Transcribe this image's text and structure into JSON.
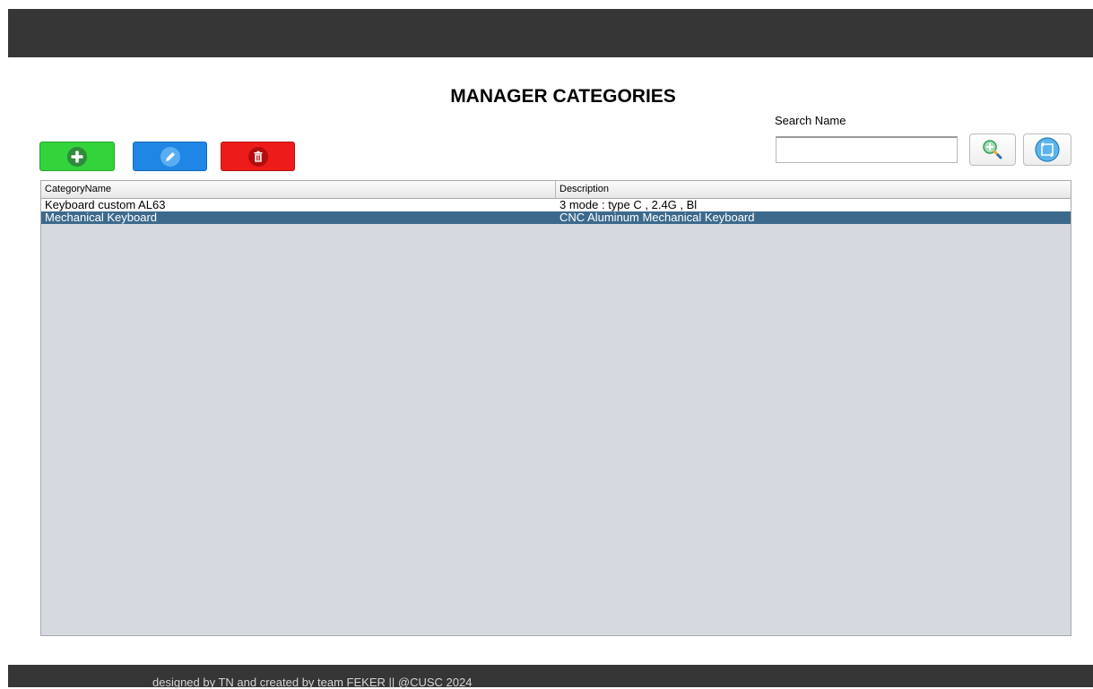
{
  "page": {
    "title": "MANAGER CATEGORIES",
    "footer_text": "designed by TN and created by team FEKER || @CUSC 2024"
  },
  "search": {
    "label": "Search Name",
    "value": "",
    "search_button_icon": "search-add-icon",
    "refresh_button_icon": "refresh-icon"
  },
  "toolbar": {
    "add_icon": "plus-icon",
    "edit_icon": "pencil-icon",
    "delete_icon": "trash-icon"
  },
  "table": {
    "columns": [
      "CategoryName",
      "Description"
    ],
    "rows": [
      {
        "name": "Keyboard custom AL63",
        "description": "3 mode : type C , 2.4G , Bl",
        "selected": false
      },
      {
        "name": "Mechanical Keyboard",
        "description": "CNC Aluminum Mechanical Keyboard",
        "selected": true
      }
    ]
  },
  "colors": {
    "header_bar": "#363636",
    "add_button": "#33d33c",
    "edit_button": "#1f86e6",
    "delete_button": "#ee1b1b",
    "selected_row": "#3d6a8c",
    "table_background": "#d6d9e0"
  }
}
